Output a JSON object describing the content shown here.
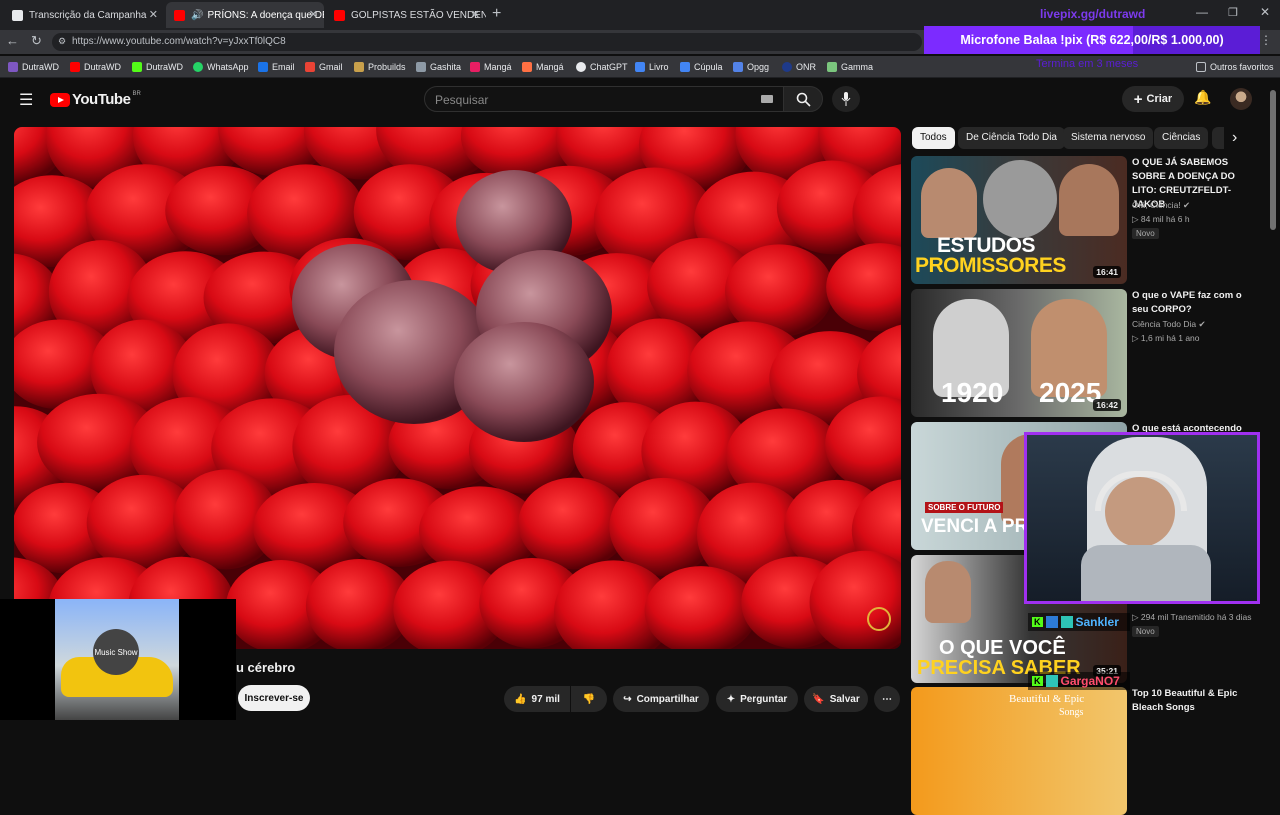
{
  "browser": {
    "tabs": [
      {
        "label": "Transcrição da Campanha"
      },
      {
        "label": "PRÍONS: A doença que DERR"
      },
      {
        "label": "GOLPISTAS ESTÃO VENDENDO FI"
      }
    ],
    "url": "https://www.youtube.com/watch?v=yJxxTf0lQC8",
    "bookmarks": [
      "DutraWD",
      "DutraWD",
      "DutraWD",
      "WhatsApp",
      "Email",
      "Gmail",
      "Probuilds",
      "Gashita",
      "Mangá",
      "Mangá",
      "ChatGPT",
      "Livro",
      "Cúpula",
      "Opgg",
      "ONR",
      "Gamma"
    ],
    "other_bookmarks": "Outros favoritos"
  },
  "overlay": {
    "livepix": "livepix.gg/dutrawd",
    "goal": "Microfone Balaa !pix (R$ 622,00/R$ 1.000,00)",
    "goal_progress": 0.622,
    "goal_sub": "Termina em 3 meses",
    "chat_names": [
      "Sankler",
      "GargaNO7"
    ],
    "music_widget": "Music Show"
  },
  "youtube": {
    "logo": "YouTube",
    "region": "BR",
    "search_placeholder": "Pesquisar",
    "create_label": "Criar",
    "chips": [
      "Todos",
      "De Ciência Todo Dia",
      "Sistema nervoso",
      "Ciências"
    ],
    "video_title_fragment": "u cérebro",
    "subscribe_label": "Inscrever-se",
    "likes": "97 mil",
    "share_label": "Compartilhar",
    "ask_label": "Perguntar",
    "save_label": "Salvar",
    "recommended": [
      {
        "title": "O QUE JÁ SABEMOS SOBRE A DOENÇA DO LITO: CREUTZFELDT-JAKOB",
        "channel": "Olá, Ciência!",
        "meta": "84 mil  há 6 h",
        "badge": "Novo",
        "duration": "16:41",
        "thumb_text_1": "ESTUDOS",
        "thumb_text_2": "PROMISSORES"
      },
      {
        "title": "O que o VAPE faz com o seu CORPO?",
        "channel": "Ciência Todo Dia",
        "meta": "1,6 mi  há 1 ano",
        "duration": "16:42",
        "thumb_text_1": "1920",
        "thumb_text_2": "2025"
      },
      {
        "title": "O que está acontecendo",
        "thumb_text_1": "SOBRE O FUTURO",
        "thumb_text_2": "VENCI A PRIME"
      },
      {
        "meta": "294 mil  Transmitido há 3 dias",
        "badge": "Novo",
        "duration": "35:21",
        "thumb_text_1": "O QUE VOCÊ",
        "thumb_text_2": "PRECISA SABER"
      },
      {
        "title": "Top 10 Beautiful & Epic Bleach Songs",
        "thumb_text_1": "Beautiful & Epic",
        "thumb_text_2": "Songs"
      }
    ]
  }
}
